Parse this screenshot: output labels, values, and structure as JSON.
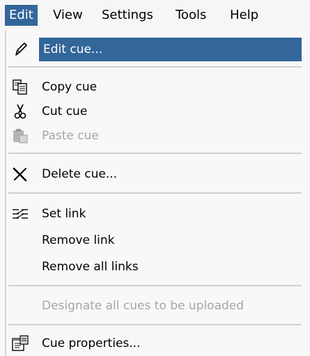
{
  "menubar": {
    "items": [
      {
        "label": "Edit"
      },
      {
        "label": "View"
      },
      {
        "label": "Settings"
      },
      {
        "label": "Tools"
      },
      {
        "label": "Help"
      }
    ]
  },
  "edit_menu": {
    "items": [
      {
        "label": "Edit cue...",
        "icon": "pencil-icon",
        "enabled": true,
        "selected": true
      },
      {
        "label": "Copy cue",
        "icon": "copy-icon",
        "enabled": true
      },
      {
        "label": "Cut cue",
        "icon": "scissors-icon",
        "enabled": true
      },
      {
        "label": "Paste cue",
        "icon": "paste-icon",
        "enabled": false
      },
      {
        "label": "Delete cue...",
        "icon": "delete-x-icon",
        "enabled": true
      },
      {
        "label": "Set link",
        "icon": "link-icon",
        "enabled": true
      },
      {
        "label": "Remove link",
        "enabled": true
      },
      {
        "label": "Remove all links",
        "enabled": true
      },
      {
        "label": "Designate all cues to be uploaded",
        "enabled": false
      },
      {
        "label": "Cue properties...",
        "icon": "properties-icon",
        "enabled": true
      }
    ]
  },
  "colors": {
    "highlight": "#336699",
    "disabled_text": "#a6a6a6",
    "menu_background": "#f8f8f8"
  }
}
